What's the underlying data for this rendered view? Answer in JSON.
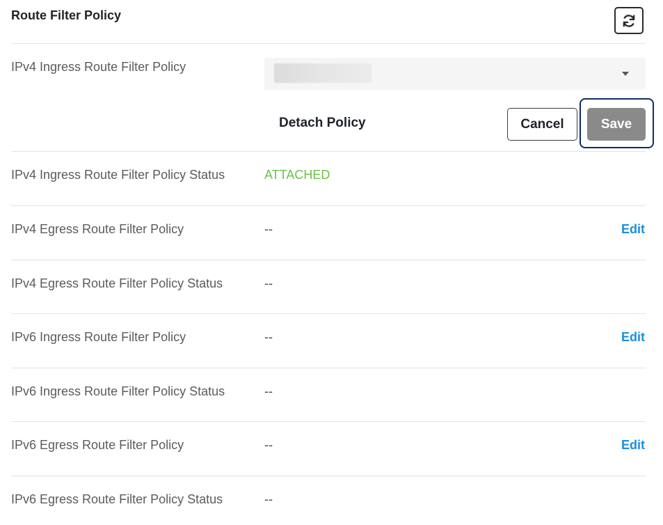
{
  "header": {
    "title": "Route Filter Policy",
    "refresh_icon": "refresh-icon"
  },
  "ipv4_ingress": {
    "label": "IPv4 Ingress Route Filter Policy",
    "select_icon": "chevron-down-icon"
  },
  "actions": {
    "detach_label": "Detach Policy",
    "cancel_label": "Cancel",
    "save_label": "Save"
  },
  "rows": [
    {
      "label": "IPv4 Ingress Route Filter Policy Status",
      "value": "ATTACHED",
      "edit": ""
    },
    {
      "label": "IPv4 Egress Route Filter Policy",
      "value": "--",
      "edit": "Edit"
    },
    {
      "label": "IPv4 Egress Route Filter Policy Status",
      "value": "--",
      "edit": ""
    },
    {
      "label": "IPv6 Ingress Route Filter Policy",
      "value": "--",
      "edit": "Edit"
    },
    {
      "label": "IPv6 Ingress Route Filter Policy Status",
      "value": "--",
      "edit": ""
    },
    {
      "label": "IPv6 Egress Route Filter Policy",
      "value": "--",
      "edit": "Edit"
    },
    {
      "label": "IPv6 Egress Route Filter Policy Status",
      "value": "--",
      "edit": ""
    }
  ],
  "colors": {
    "status_attached": "#6cc04a",
    "link": "#1a8fe0",
    "save_disabled": "#8a8a8a",
    "focus_ring": "#0d2b6b"
  }
}
